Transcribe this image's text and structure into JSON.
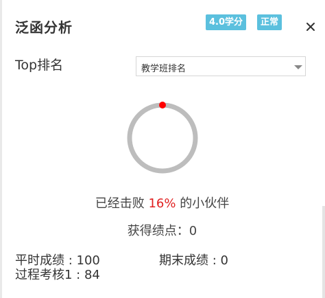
{
  "header": {
    "title": "泛函分析",
    "credits_badge": "4.0学分",
    "status_badge": "正常"
  },
  "ranking": {
    "label": "Top排名",
    "select": {
      "selected": "教学班排名"
    }
  },
  "progress": {
    "defeat_percent": 0.16
  },
  "summary": {
    "defeat_prefix": "已经击败 ",
    "defeat_percent_text": "16%",
    "defeat_suffix": " 的小伙伴",
    "points_text": "获得绩点：0"
  },
  "scores": {
    "regular": "平时成绩 : 100",
    "final": "期末成绩 : 0",
    "process": "过程考核1 : 84"
  },
  "colors": {
    "badge": "#5bc0de",
    "ring_track": "#bdbdbd",
    "ring_marker": "#ff0000",
    "percent_text": "#e02020"
  }
}
